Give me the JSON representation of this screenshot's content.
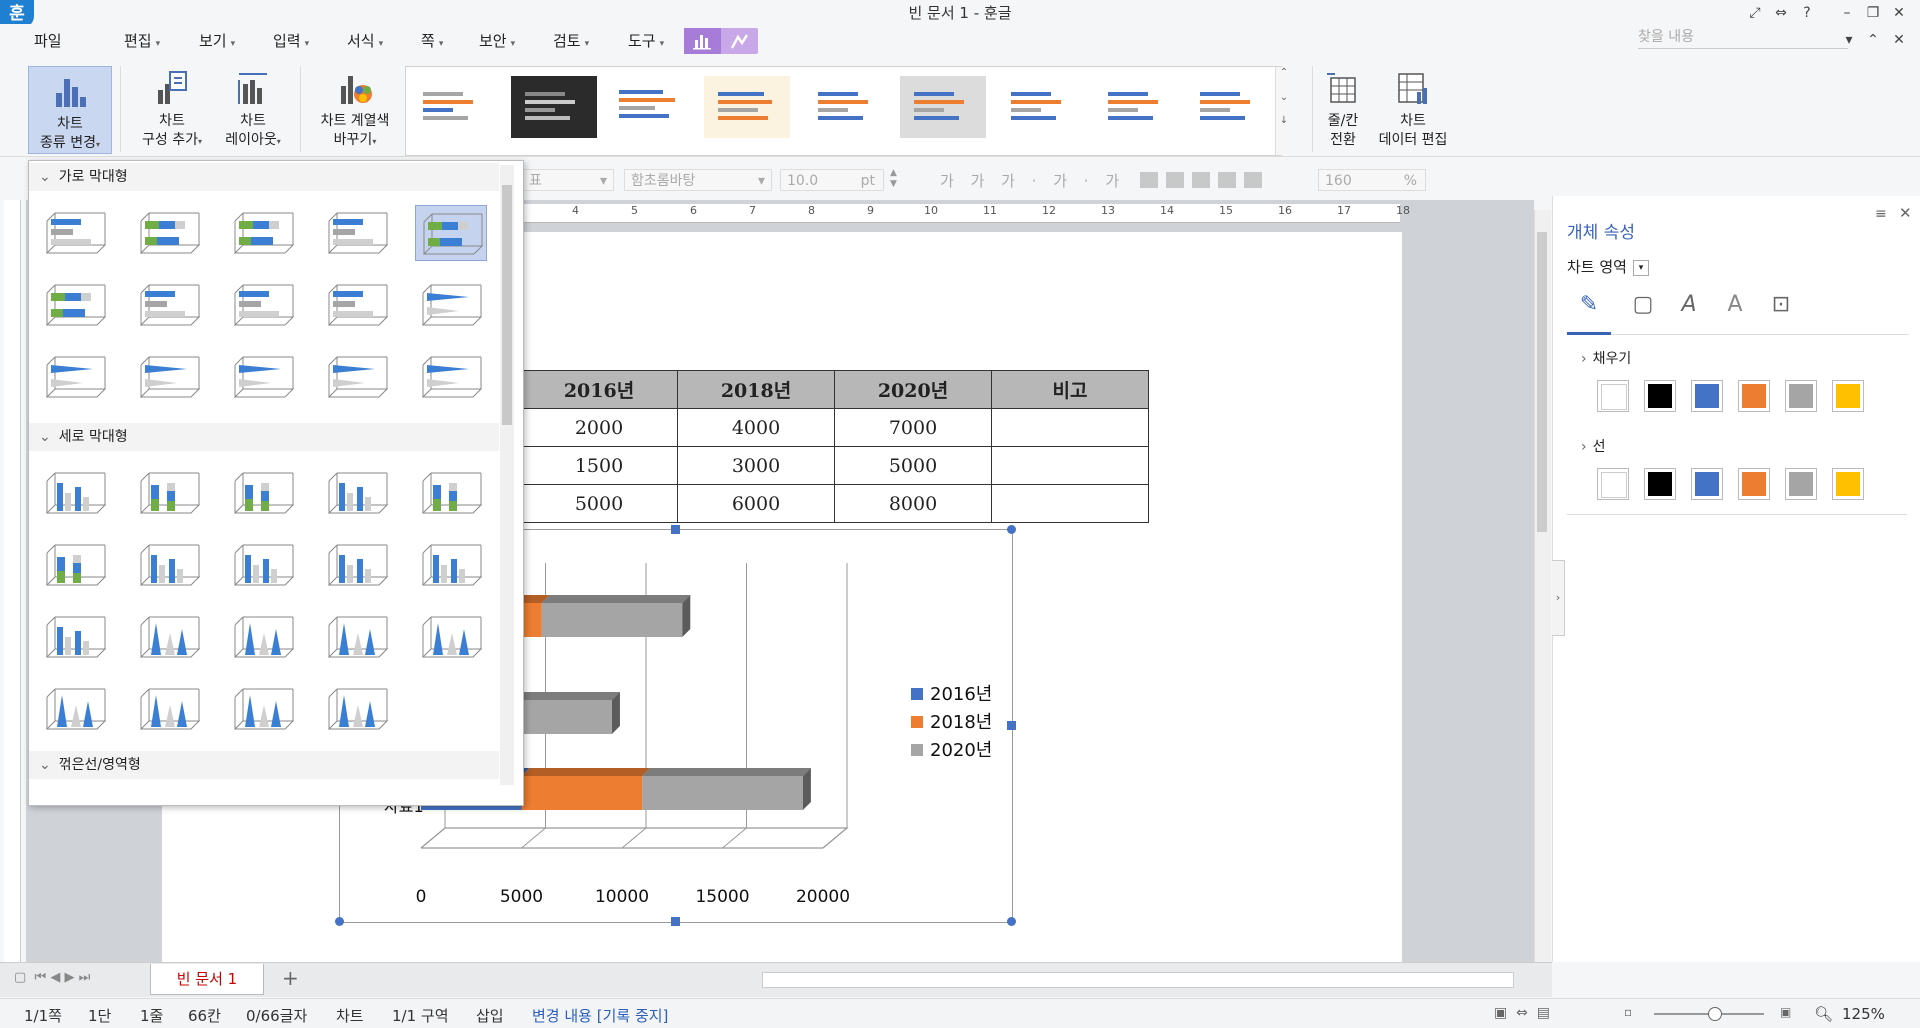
{
  "window": {
    "logo": "훈",
    "title": "빈 문서 1 - 훈글"
  },
  "menu": [
    {
      "label": "파일"
    },
    {
      "label": "편집"
    },
    {
      "label": "보기"
    },
    {
      "label": "입력"
    },
    {
      "label": "서식"
    },
    {
      "label": "쪽"
    },
    {
      "label": "보안"
    },
    {
      "label": "검토"
    },
    {
      "label": "도구"
    }
  ],
  "search": {
    "placeholder": "찾을 내용"
  },
  "ribbon": {
    "chart_type": {
      "line1": "차트",
      "line2": "종류 변경"
    },
    "chart_add": {
      "line1": "차트",
      "line2": "구성 추가"
    },
    "chart_layout": {
      "line1": "차트",
      "line2": "레이아웃"
    },
    "chart_color": {
      "line1": "차트 계열색",
      "line2": "바꾸기"
    },
    "switch_rowcol": {
      "line1": "줄/칸",
      "line2": "전환"
    },
    "edit_data": {
      "line1": "차트",
      "line2": "데이터 편집"
    }
  },
  "format_toolbar": {
    "style": "표",
    "font": "함초롬바탕",
    "size": "10.0",
    "unit": "pt",
    "zoom": "160",
    "zoom_unit": "%"
  },
  "ruler_ticks": [
    "4",
    "5",
    "6",
    "7",
    "8",
    "9",
    "10",
    "11",
    "12",
    "13",
    "14",
    "15",
    "16",
    "17",
    "18"
  ],
  "table": {
    "header": [
      "2016년",
      "2018년",
      "2020년",
      "비고"
    ],
    "rows": [
      [
        "2000",
        "4000",
        "7000",
        ""
      ],
      [
        "1500",
        "3000",
        "5000",
        ""
      ],
      [
        "5000",
        "6000",
        "8000",
        ""
      ]
    ]
  },
  "chart_data": {
    "type": "bar",
    "orientation": "horizontal",
    "stacked": true,
    "three_d": true,
    "series": [
      {
        "name": "2016년",
        "values": [
          2000,
          1500,
          5000
        ]
      },
      {
        "name": "2018년",
        "values": [
          4000,
          3000,
          6000
        ]
      },
      {
        "name": "2020년",
        "values": [
          7000,
          5000,
          8000
        ]
      }
    ],
    "visible_category_label": "자료1",
    "x_ticks": [
      "0",
      "5000",
      "10000",
      "15000",
      "20000"
    ],
    "xlim": [
      0,
      20000
    ],
    "legend": "right",
    "colors": {
      "2016년": "#4472c4",
      "2018년": "#ed7d31",
      "2020년": "#a5a5a5"
    }
  },
  "chart_type_panel": {
    "sections": [
      "가로 막대형",
      "세로 막대형",
      "꺾은선/영역형"
    ]
  },
  "right_pane": {
    "title": "개체 속성",
    "target": "차트 영역",
    "fill_label": "채우기",
    "line_label": "선",
    "colors": [
      "#ffffff",
      "#000000",
      "#4472c4",
      "#ed7d31",
      "#a5a5a5",
      "#ffc000"
    ]
  },
  "doc_tab": {
    "label": "빈 문서 1",
    "add": "+"
  },
  "status": {
    "page": "1/1쪽",
    "col": "1단",
    "line": "1줄",
    "chars": "66칸",
    "count": "0/66글자",
    "object": "차트",
    "section": "1/1 구역",
    "mode": "삽입",
    "track": "변경 내용 [기록 중지]",
    "zoom": "125%"
  }
}
